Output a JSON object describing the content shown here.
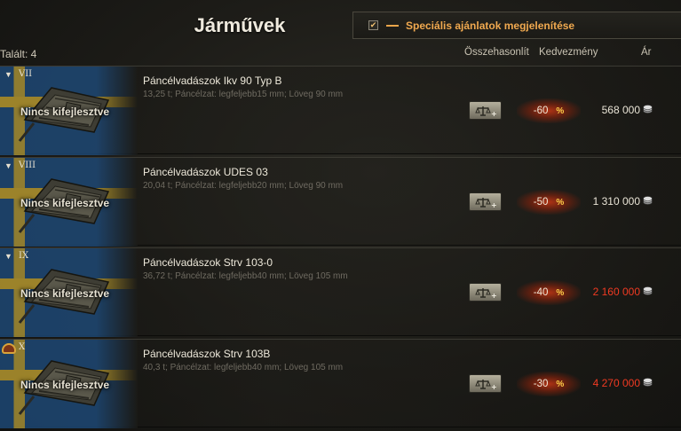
{
  "header": {
    "title": "Járművek",
    "special_offers_label": "Speciális ajánlatok megjelenítése",
    "special_offers_checked": true,
    "count_label": "Talált: 4",
    "columns": {
      "compare": "Összehasonlít",
      "discount": "Kedvezmény",
      "price": "Ár"
    }
  },
  "vehicles": [
    {
      "tier": "VII",
      "status": "Nincs kifejlesztve",
      "name": "Páncélvadászok Ikv 90 Typ B",
      "specs": "13,25 t; Páncélzat: legfeljebb15 mm; Löveg 90 mm",
      "discount": "-60",
      "pct_symbol": "%",
      "price": "568 000",
      "price_highlight": false,
      "elite": false
    },
    {
      "tier": "VIII",
      "status": "Nincs kifejlesztve",
      "name": "Páncélvadászok UDES 03",
      "specs": "20,04 t; Páncélzat: legfeljebb20 mm; Löveg 90 mm",
      "discount": "-50",
      "pct_symbol": "%",
      "price": "1 310 000",
      "price_highlight": false,
      "elite": false
    },
    {
      "tier": "IX",
      "status": "Nincs kifejlesztve",
      "name": "Páncélvadászok Strv 103-0",
      "specs": "36,72 t; Páncélzat: legfeljebb40 mm; Löveg 105 mm",
      "discount": "-40",
      "pct_symbol": "%",
      "price": "2 160 000",
      "price_highlight": true,
      "elite": false
    },
    {
      "tier": "X",
      "status": "Nincs kifejlesztve",
      "name": "Páncélvadászok Strv 103B",
      "specs": "40,3 t; Páncélzat: legfeljebb40 mm; Löveg 105 mm",
      "discount": "-30",
      "pct_symbol": "%",
      "price": "4 270 000",
      "price_highlight": true,
      "elite": true
    }
  ],
  "icons": {
    "tier_arrow": "triangle-down-icon",
    "compare": "scales-plus-icon",
    "currency": "silver-coin-icon",
    "elite": "elite-badge-icon"
  },
  "colors": {
    "accent_orange": "#f0a94f",
    "price_red": "#f03a22",
    "discount_pct": "#ffcf4a"
  }
}
